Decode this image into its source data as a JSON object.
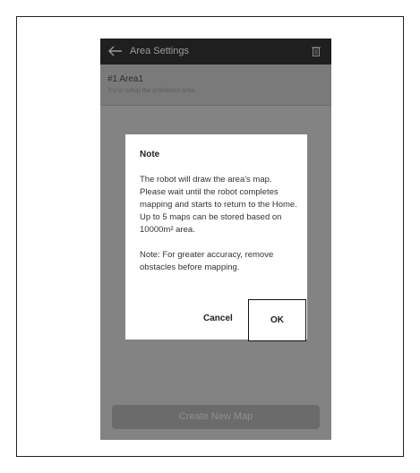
{
  "app": {
    "title": "Area Settings",
    "icons": {
      "back": "back-arrow-icon",
      "delete": "trash-icon"
    }
  },
  "area": {
    "name": "#1 Area1",
    "hint": "Try to setup the prohibited area."
  },
  "dialog": {
    "title": "Note",
    "paragraph1": "The robot will draw the area's map. Please wait until the robot completes mapping and starts to return to the Home. Up to 5 maps can be stored based on 10000m² area.",
    "paragraph2": "Note: For greater accuracy, remove obstacles before mapping.",
    "cancel_label": "Cancel",
    "ok_label": "OK"
  },
  "footer": {
    "create_label": "Create New Map"
  },
  "colors": {
    "overlay": "#838383",
    "titlebar": "#1f1f1f",
    "dialog": "#ffffff"
  }
}
